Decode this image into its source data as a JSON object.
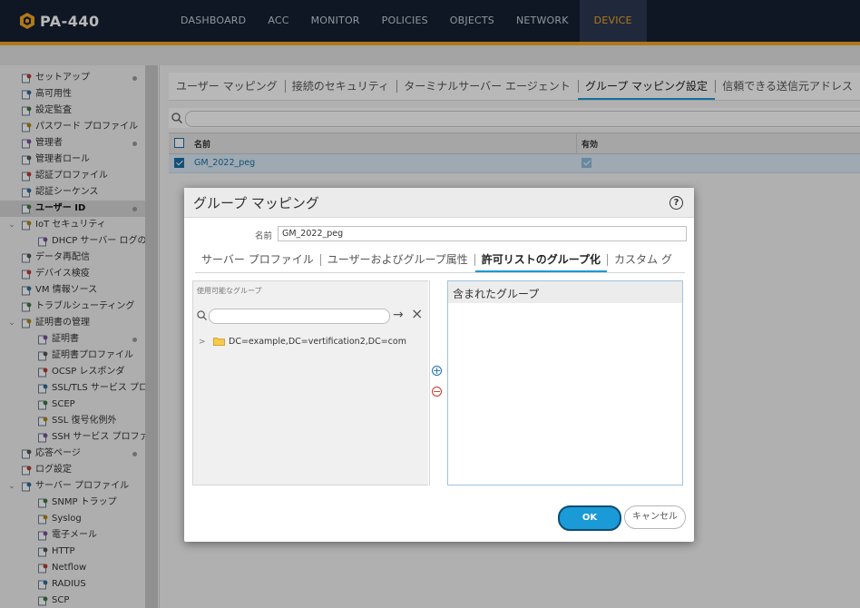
{
  "app": {
    "title": "PA-440"
  },
  "nav": {
    "tabs": [
      "DASHBOARD",
      "ACC",
      "MONITOR",
      "POLICIES",
      "OBJECTS",
      "NETWORK",
      "DEVICE"
    ],
    "active_tab": "DEVICE"
  },
  "sidebar": {
    "items": [
      {
        "label": "セットアップ",
        "icon": "gear-icon",
        "dot": true
      },
      {
        "label": "高可用性",
        "icon": "ha-icon"
      },
      {
        "label": "設定監査",
        "icon": "audit-icon"
      },
      {
        "label": "パスワード プロファイル",
        "icon": "key-icon"
      },
      {
        "label": "管理者",
        "icon": "user-icon",
        "dot": true
      },
      {
        "label": "管理者ロール",
        "icon": "role-icon"
      },
      {
        "label": "認証プロファイル",
        "icon": "auth-profile-icon"
      },
      {
        "label": "認証シーケンス",
        "icon": "auth-sequence-icon"
      },
      {
        "label": "ユーザー ID",
        "icon": "user-id-icon",
        "dot": true
      },
      {
        "label": "IoT セキュリティ",
        "icon": "iot-icon"
      },
      {
        "label": "DHCP サーバー ログの",
        "icon": "dhcp-icon"
      },
      {
        "label": "データ再配信",
        "icon": "redistribution-icon"
      },
      {
        "label": "デバイス検疫",
        "icon": "quarantine-icon"
      },
      {
        "label": "VM 情報ソース",
        "icon": "vm-icon"
      },
      {
        "label": "トラブルシューティング",
        "icon": "troubleshoot-icon"
      },
      {
        "label": "証明書の管理",
        "icon": "cert-mgmt-icon"
      },
      {
        "label": "証明書",
        "icon": "certificate-icon",
        "dot": true
      },
      {
        "label": "証明書プロファイル",
        "icon": "cert-profile-icon"
      },
      {
        "label": "OCSP レスポンダ",
        "icon": "ocsp-icon"
      },
      {
        "label": "SSL/TLS サービス プロ",
        "icon": "ssl-tls-icon"
      },
      {
        "label": "SCEP",
        "icon": "scep-icon"
      },
      {
        "label": "SSL 復号化例外",
        "icon": "lock-icon"
      },
      {
        "label": "SSH サービス プロファ",
        "icon": "ssh-icon"
      },
      {
        "label": "応答ページ",
        "icon": "response-page-icon",
        "dot": true
      },
      {
        "label": "ログ設定",
        "icon": "log-settings-icon"
      },
      {
        "label": "サーバー プロファイル",
        "icon": "server-profile-icon"
      },
      {
        "label": "SNMP トラップ",
        "icon": "snmp-icon"
      },
      {
        "label": "Syslog",
        "icon": "syslog-icon"
      },
      {
        "label": "電子メール",
        "icon": "email-icon"
      },
      {
        "label": "HTTP",
        "icon": "http-icon"
      },
      {
        "label": "Netflow",
        "icon": "netflow-icon"
      },
      {
        "label": "RADIUS",
        "icon": "radius-icon"
      },
      {
        "label": "SCP",
        "icon": "scp-icon"
      }
    ]
  },
  "main": {
    "subtabs": [
      "ユーザー マッピング",
      "接続のセキュリティ",
      "ターミナルサーバー エージェント",
      "グループ マッピング設定",
      "信頼できる送信元アドレス"
    ],
    "active_subtab": "グループ マッピング設定",
    "grid": {
      "columns": [
        "名前",
        "有効"
      ],
      "rows": [
        {
          "name": "GM_2022_peg",
          "enabled": true
        }
      ]
    }
  },
  "modal": {
    "title": "グループ マッピング",
    "name_label": "名前",
    "name_value": "GM_2022_peg",
    "tabs": [
      "サーバー プロファイル",
      "ユーザーおよびグループ属性",
      "許可リストのグループ化",
      "カスタム グ"
    ],
    "active_tab": "許可リストのグループ化",
    "available_title": "使用可能なグループ",
    "available_tree": [
      "DC=example,DC=vertification2,DC=com"
    ],
    "included_title": "含まれたグループ",
    "ok_label": "OK",
    "cancel_label": "キャンセル"
  },
  "colors": {
    "nav_bg": "#152033",
    "nav_accent": "#f5a623",
    "primary_button": "#1a9ad6",
    "tab_underline": "#1a9ad6"
  }
}
